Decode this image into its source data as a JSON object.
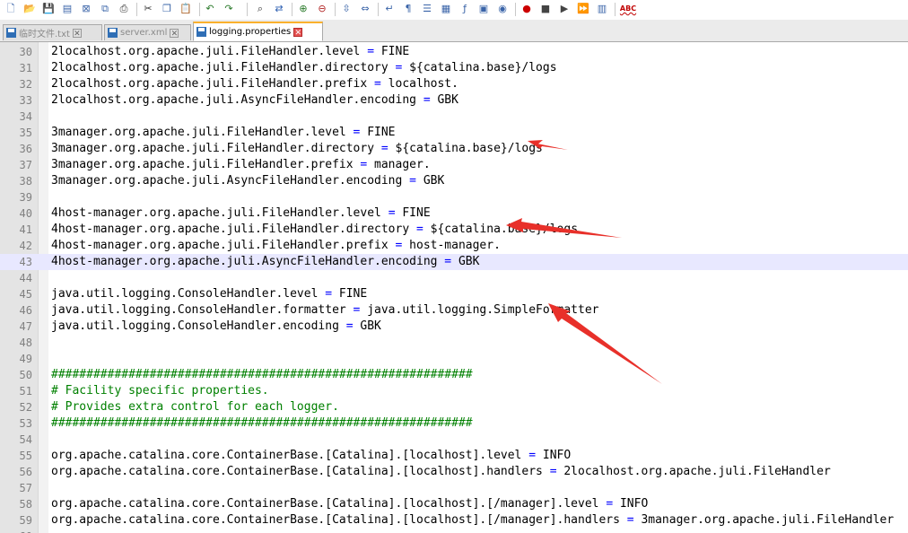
{
  "tabs": [
    {
      "label": "临时文件.txt",
      "active": false
    },
    {
      "label": "server.xml",
      "active": false
    },
    {
      "label": "logging.properties",
      "active": true
    }
  ],
  "toolbar": {
    "icons": [
      "new-file-icon",
      "open-folder-icon",
      "save-icon",
      "save-all-icon",
      "close-icon",
      "close-all-icon",
      "print-icon",
      "cut-icon",
      "copy-icon",
      "paste-icon",
      "undo-icon",
      "redo-icon",
      "find-icon",
      "replace-icon",
      "zoom-in-icon",
      "zoom-out-icon",
      "sync-vertical-icon",
      "sync-horizontal-icon",
      "word-wrap-icon",
      "show-all-chars-icon",
      "indent-guide-icon",
      "document-map-icon",
      "function-list-icon",
      "folder-workspace-icon",
      "monitor-icon",
      "record-macro-icon",
      "stop-macro-icon",
      "play-macro-icon",
      "run-macro-multiple-icon",
      "save-macro-icon",
      "spell-check-icon"
    ],
    "spell_check_label": "ABC"
  },
  "editor": {
    "current_line": 43,
    "lines": [
      {
        "n": "30",
        "text": "2localhost.org.apache.juli.FileHandler.level = FINE"
      },
      {
        "n": "31",
        "text": "2localhost.org.apache.juli.FileHandler.directory = ${catalina.base}/logs"
      },
      {
        "n": "32",
        "text": "2localhost.org.apache.juli.FileHandler.prefix = localhost."
      },
      {
        "n": "33",
        "text": "2localhost.org.apache.juli.AsyncFileHandler.encoding = GBK"
      },
      {
        "n": "34",
        "text": ""
      },
      {
        "n": "35",
        "text": "3manager.org.apache.juli.FileHandler.level = FINE"
      },
      {
        "n": "36",
        "text": "3manager.org.apache.juli.FileHandler.directory = ${catalina.base}/logs"
      },
      {
        "n": "37",
        "text": "3manager.org.apache.juli.FileHandler.prefix = manager."
      },
      {
        "n": "38",
        "text": "3manager.org.apache.juli.AsyncFileHandler.encoding = GBK"
      },
      {
        "n": "39",
        "text": ""
      },
      {
        "n": "40",
        "text": "4host-manager.org.apache.juli.FileHandler.level = FINE"
      },
      {
        "n": "41",
        "text": "4host-manager.org.apache.juli.FileHandler.directory = ${catalina.base}/logs"
      },
      {
        "n": "42",
        "text": "4host-manager.org.apache.juli.FileHandler.prefix = host-manager."
      },
      {
        "n": "43",
        "text": "4host-manager.org.apache.juli.AsyncFileHandler.encoding = GBK"
      },
      {
        "n": "44",
        "text": ""
      },
      {
        "n": "45",
        "text": "java.util.logging.ConsoleHandler.level = FINE"
      },
      {
        "n": "46",
        "text": "java.util.logging.ConsoleHandler.formatter = java.util.logging.SimpleFormatter"
      },
      {
        "n": "47",
        "text": "java.util.logging.ConsoleHandler.encoding = GBK"
      },
      {
        "n": "48",
        "text": ""
      },
      {
        "n": "49",
        "text": ""
      },
      {
        "n": "50",
        "text": "############################################################"
      },
      {
        "n": "51",
        "text": "# Facility specific properties."
      },
      {
        "n": "52",
        "text": "# Provides extra control for each logger."
      },
      {
        "n": "53",
        "text": "############################################################"
      },
      {
        "n": "54",
        "text": ""
      },
      {
        "n": "55",
        "text": "org.apache.catalina.core.ContainerBase.[Catalina].[localhost].level = INFO"
      },
      {
        "n": "56",
        "text": "org.apache.catalina.core.ContainerBase.[Catalina].[localhost].handlers = 2localhost.org.apache.juli.FileHandler"
      },
      {
        "n": "57",
        "text": ""
      },
      {
        "n": "58",
        "text": "org.apache.catalina.core.ContainerBase.[Catalina].[localhost].[/manager].level = INFO"
      },
      {
        "n": "59",
        "text": "org.apache.catalina.core.ContainerBase.[Catalina].[localhost].[/manager].handlers = 3manager.org.apache.juli.FileHandler"
      },
      {
        "n": "60",
        "text": ""
      }
    ]
  },
  "colors": {
    "annotation_arrow": "#e8302a",
    "comment": "#008000",
    "operator": "#0000ff",
    "current_line_bg": "#e8e8ff",
    "active_tab_accent": "#fab12d"
  }
}
